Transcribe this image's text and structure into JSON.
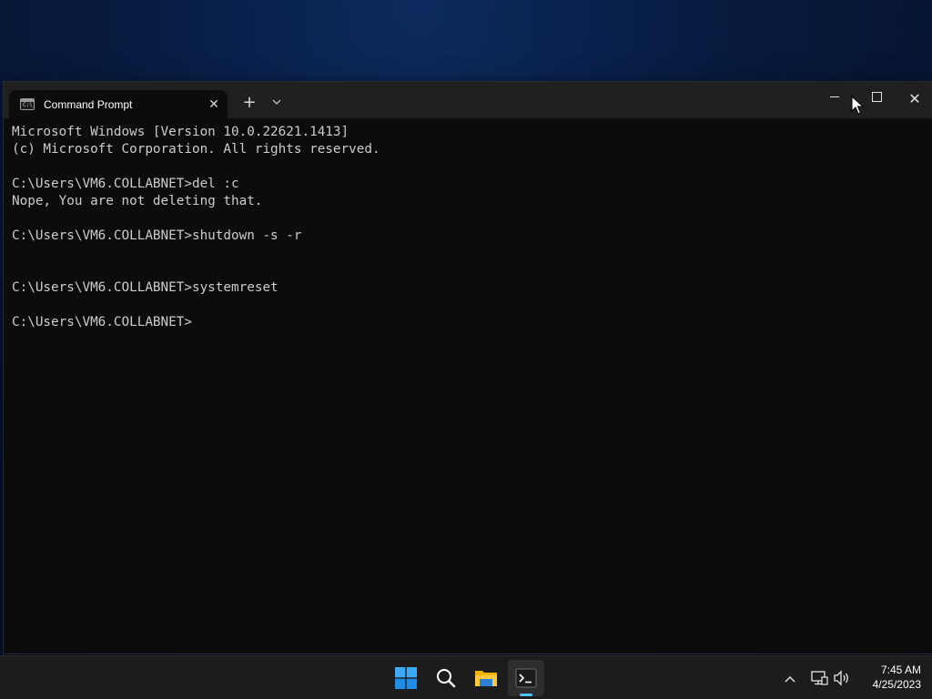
{
  "window": {
    "tab_title": "Command Prompt",
    "tab_icon_text": "C:\\.",
    "tab_close": "✕",
    "new_tab": "+",
    "tab_dropdown": "⌄",
    "close_glyph": "✕"
  },
  "console": {
    "lines": [
      "Microsoft Windows [Version 10.0.22621.1413]",
      "(c) Microsoft Corporation. All rights reserved.",
      "",
      "C:\\Users\\VM6.COLLABNET>del :c",
      "Nope, You are not deleting that.",
      "",
      "C:\\Users\\VM6.COLLABNET>shutdown -s -r",
      "",
      "",
      "C:\\Users\\VM6.COLLABNET>systemreset",
      "",
      "C:\\Users\\VM6.COLLABNET>"
    ]
  },
  "taskbar": {
    "tray_chevron": "^",
    "time": "7:45 AM",
    "date": "4/25/2023"
  },
  "colors": {
    "console_bg": "#0c0c0c",
    "console_text": "#cccccc",
    "titlebar_bg": "#202020",
    "taskbar_bg": "#1c1c1c",
    "accent": "#4cc2ff"
  }
}
